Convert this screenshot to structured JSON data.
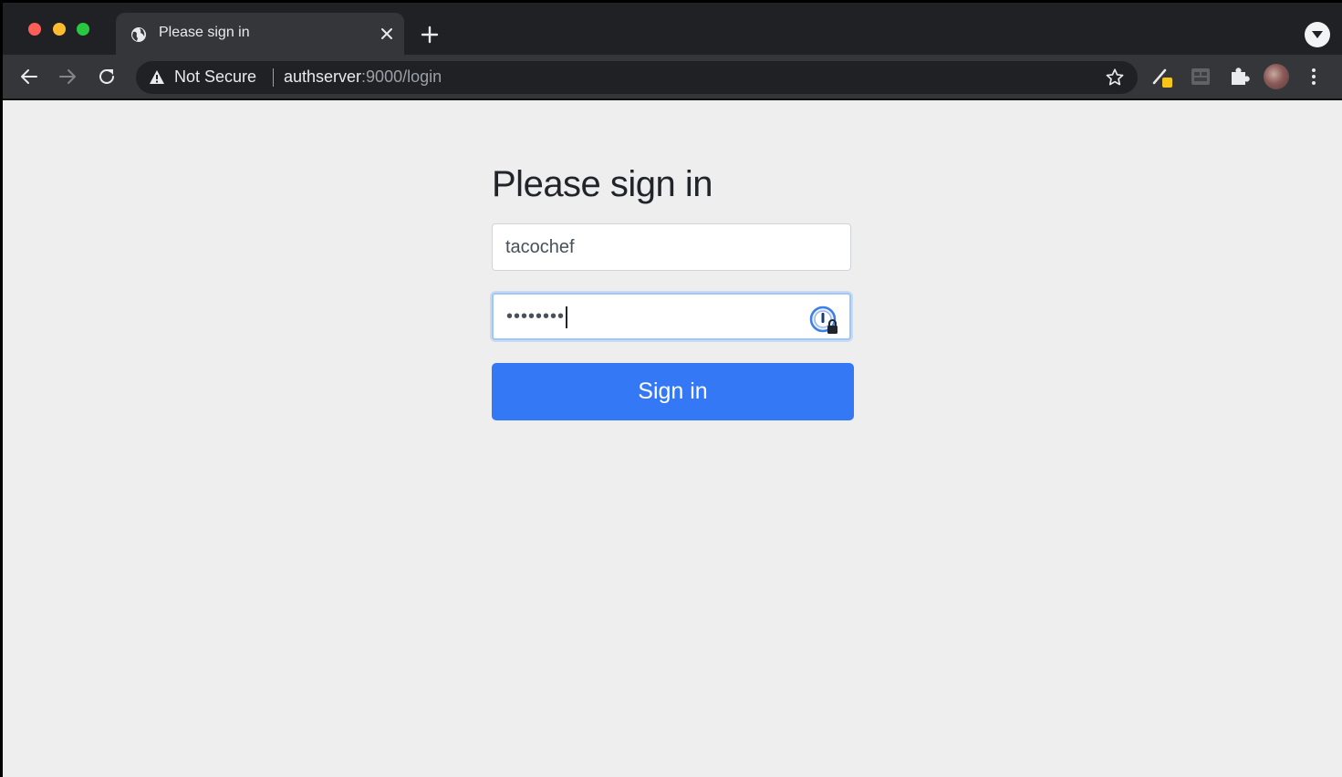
{
  "browser": {
    "tab": {
      "title": "Please sign in",
      "favicon": "globe-icon"
    },
    "address_bar": {
      "security_label": "Not Secure",
      "url_host": "authserver",
      "url_rest": ":9000/login"
    }
  },
  "form": {
    "heading": "Please sign in",
    "username_value": "tacochef",
    "password_masked": "••••••••",
    "submit_label": "Sign in"
  },
  "colors": {
    "submit_button": "#3478f6",
    "page_background": "#eeeeee",
    "browser_chrome": "#35363a"
  }
}
